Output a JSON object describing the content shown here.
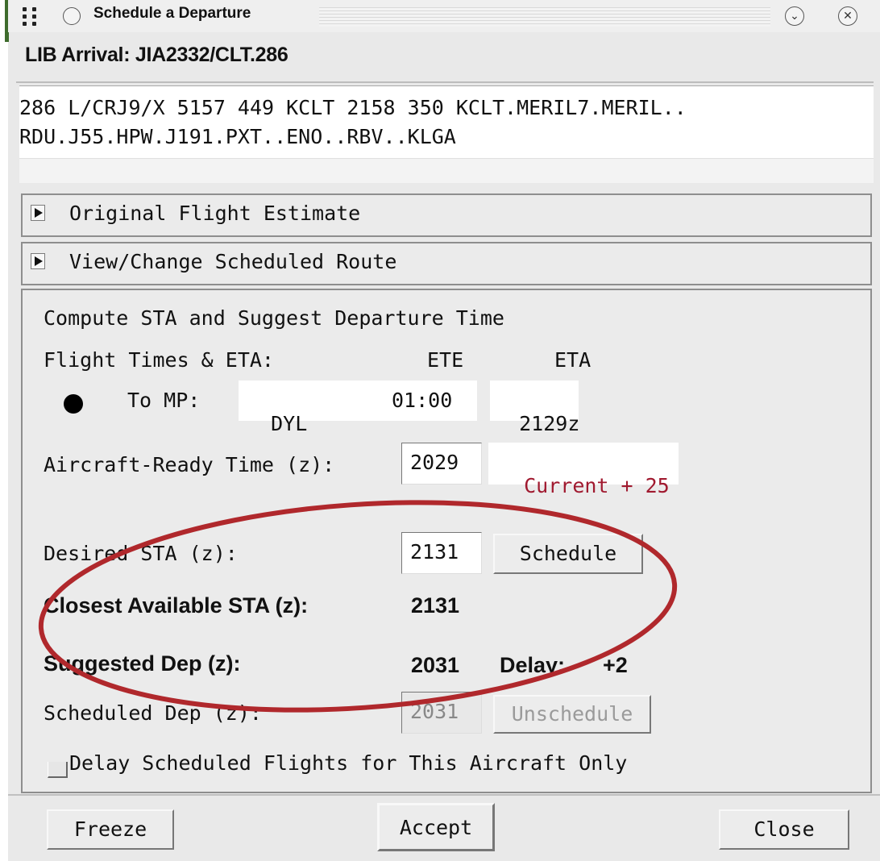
{
  "window": {
    "title": "Schedule a Departure",
    "minimize_glyph": "⌄",
    "close_glyph": "✕"
  },
  "header": {
    "arrival_label": "LIB Arrival: JIA2332/CLT.286"
  },
  "route": {
    "line1": "286 L/CRJ9/X 5157 449 KCLT 2158 350 KCLT.MERIL7.MERIL..",
    "line2": "RDU.J55.HPW.J191.PXT..ENO..RBV..KLGA"
  },
  "sections": {
    "original_estimate": "Original Flight Estimate",
    "view_change_route": "View/Change Scheduled Route"
  },
  "compute": {
    "heading": "Compute STA and Suggest Departure Time",
    "flight_times_label": "Flight Times & ETA:",
    "ete_header": "ETE",
    "eta_header": "ETA",
    "to_mp_label": "To MP:",
    "mp_value": "DYL",
    "ete_value": "01:00",
    "eta_value": "2129z",
    "aircraft_ready_label": "Aircraft-Ready Time (z):",
    "aircraft_ready_value": "2029",
    "current_offset": "Current + 25",
    "current_offset_color": "#a0192f",
    "desired_sta_label": "Desired STA (z):",
    "desired_sta_value": "2131",
    "schedule_button": "Schedule",
    "closest_sta_label": "Closest Available STA (z):",
    "closest_sta_value": "2131",
    "suggested_dep_label": "Suggested Dep (z):",
    "suggested_dep_value": "2031",
    "delay_label": "Delay:",
    "delay_value": "+2",
    "scheduled_dep_label": "Scheduled Dep (z):",
    "scheduled_dep_value": "2031",
    "unschedule_button": "Unschedule",
    "delay_checkbox_label": "Delay Scheduled Flights for This Aircraft Only",
    "delay_checkbox_checked": false
  },
  "footer": {
    "freeze_button": "Freeze",
    "accept_button": "Accept",
    "close_button": "Close"
  },
  "annotation": {
    "ellipse_color": "#b0282c"
  }
}
